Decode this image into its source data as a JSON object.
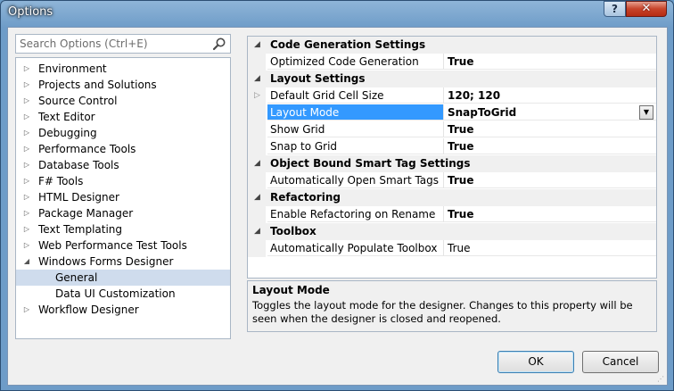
{
  "window": {
    "title": "Options",
    "help_label": "?",
    "close_label": "✕"
  },
  "search": {
    "placeholder": "Search Options (Ctrl+E)",
    "icon": "search-icon"
  },
  "tree": {
    "items": [
      {
        "label": "Environment",
        "expanded": false
      },
      {
        "label": "Projects and Solutions",
        "expanded": false
      },
      {
        "label": "Source Control",
        "expanded": false
      },
      {
        "label": "Text Editor",
        "expanded": false
      },
      {
        "label": "Debugging",
        "expanded": false
      },
      {
        "label": "Performance Tools",
        "expanded": false
      },
      {
        "label": "Database Tools",
        "expanded": false
      },
      {
        "label": "F# Tools",
        "expanded": false
      },
      {
        "label": "HTML Designer",
        "expanded": false
      },
      {
        "label": "Package Manager",
        "expanded": false
      },
      {
        "label": "Text Templating",
        "expanded": false
      },
      {
        "label": "Web Performance Test Tools",
        "expanded": false
      },
      {
        "label": "Windows Forms Designer",
        "expanded": true
      },
      {
        "label": "General",
        "child": true,
        "selected": true
      },
      {
        "label": "Data UI Customization",
        "child": true
      },
      {
        "label": "Workflow Designer",
        "expanded": false
      }
    ]
  },
  "grid": {
    "rows": [
      {
        "kind": "category",
        "label": "Code Generation Settings"
      },
      {
        "kind": "property",
        "name": "Optimized Code Generation",
        "value": "True",
        "bold": true
      },
      {
        "kind": "category",
        "label": "Layout Settings"
      },
      {
        "kind": "property",
        "name": "Default Grid Cell Size",
        "value": "120; 120",
        "bold": true,
        "expandable": true
      },
      {
        "kind": "property",
        "name": "Layout Mode",
        "value": "SnapToGrid",
        "bold": true,
        "selected": true,
        "dropdown": true
      },
      {
        "kind": "property",
        "name": "Show Grid",
        "value": "True",
        "bold": true
      },
      {
        "kind": "property",
        "name": "Snap to Grid",
        "value": "True",
        "bold": true
      },
      {
        "kind": "category",
        "label": "Object Bound Smart Tag Settings"
      },
      {
        "kind": "property",
        "name": "Automatically Open Smart Tags",
        "value": "True",
        "bold": true
      },
      {
        "kind": "category",
        "label": "Refactoring"
      },
      {
        "kind": "property",
        "name": "Enable Refactoring on Rename",
        "value": "True",
        "bold": true
      },
      {
        "kind": "category",
        "label": "Toolbox"
      },
      {
        "kind": "property",
        "name": "Automatically Populate Toolbox",
        "value": "True",
        "bold": false
      }
    ]
  },
  "description": {
    "title": "Layout Mode",
    "text": "Toggles the layout mode for the designer. Changes to this property will be seen when the designer is closed and reopened."
  },
  "buttons": {
    "ok": "OK",
    "cancel": "Cancel"
  }
}
